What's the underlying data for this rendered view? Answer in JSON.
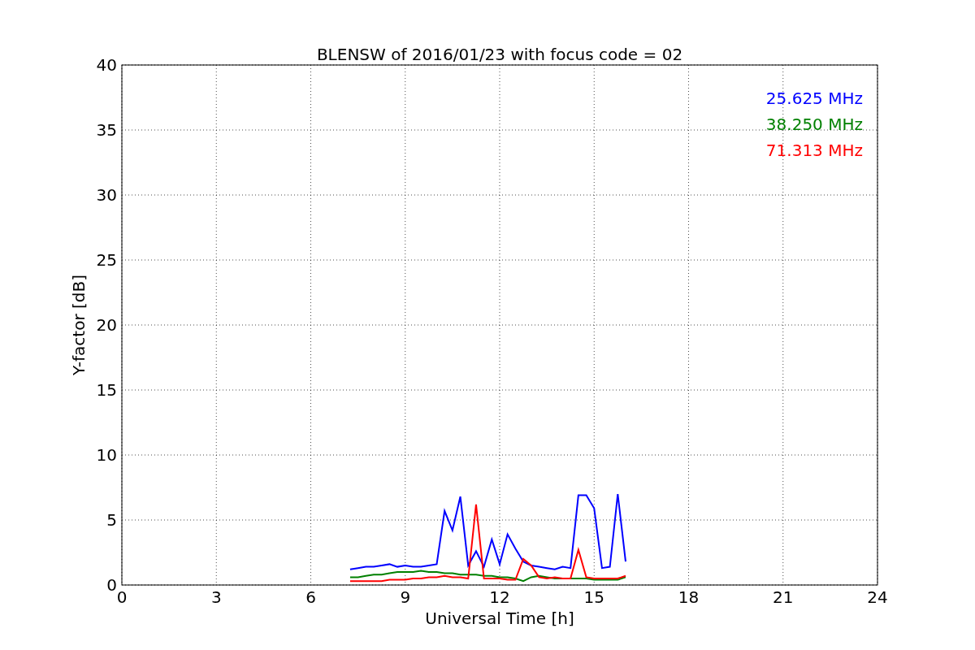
{
  "chart_data": {
    "type": "line",
    "grid": true,
    "title": "BLENSW of 2016/01/23 with focus code = 02",
    "xlabel": "Universal Time [h]",
    "ylabel": "Y-factor [dB]",
    "xlim": [
      0,
      24
    ],
    "ylim": [
      0,
      40
    ],
    "xticks": [
      0,
      3,
      6,
      9,
      12,
      15,
      18,
      21,
      24
    ],
    "yticks": [
      0,
      5,
      10,
      15,
      20,
      25,
      30,
      35,
      40
    ],
    "x": [
      7.25,
      7.5,
      7.75,
      8,
      8.25,
      8.5,
      8.75,
      9,
      9.25,
      9.5,
      9.75,
      10,
      10.25,
      10.5,
      10.75,
      11,
      11.25,
      11.5,
      11.75,
      12,
      12.25,
      12.5,
      12.75,
      13,
      13.25,
      13.5,
      13.75,
      14,
      14.25,
      14.5,
      14.75,
      15,
      15.25,
      15.5,
      15.75,
      16
    ],
    "series": [
      {
        "name": "25.625 MHz",
        "color": "#0000ff",
        "values": [
          1.2,
          1.3,
          1.4,
          1.4,
          1.5,
          1.6,
          1.4,
          1.5,
          1.4,
          1.4,
          1.5,
          1.6,
          5.7,
          4.2,
          6.8,
          1.5,
          2.6,
          1.4,
          3.5,
          1.6,
          3.9,
          2.8,
          1.8,
          1.5,
          1.4,
          1.3,
          1.2,
          1.4,
          1.3,
          6.9,
          6.9,
          5.9,
          1.3,
          1.4,
          7.0,
          1.8
        ]
      },
      {
        "name": "38.250 MHz",
        "color": "#008000",
        "values": [
          0.6,
          0.6,
          0.7,
          0.8,
          0.8,
          0.9,
          1.0,
          1.0,
          1.0,
          1.1,
          1.0,
          1.0,
          0.9,
          0.9,
          0.8,
          0.8,
          0.8,
          0.7,
          0.7,
          0.6,
          0.6,
          0.5,
          0.3,
          0.6,
          0.7,
          0.6,
          0.5,
          0.5,
          0.5,
          0.5,
          0.5,
          0.4,
          0.4,
          0.4,
          0.4,
          0.6
        ]
      },
      {
        "name": "71.313 MHz",
        "color": "#ff0000",
        "values": [
          0.3,
          0.3,
          0.3,
          0.3,
          0.3,
          0.4,
          0.4,
          0.4,
          0.5,
          0.5,
          0.6,
          0.6,
          0.7,
          0.6,
          0.6,
          0.5,
          6.2,
          0.5,
          0.5,
          0.5,
          0.4,
          0.4,
          2.0,
          1.5,
          0.6,
          0.5,
          0.6,
          0.5,
          0.5,
          2.7,
          0.6,
          0.5,
          0.5,
          0.5,
          0.5,
          0.7
        ]
      }
    ]
  }
}
